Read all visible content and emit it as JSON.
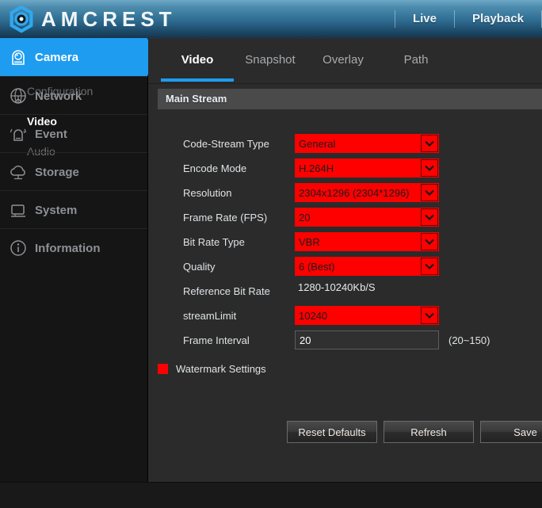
{
  "header": {
    "brand": "AMCREST",
    "logo_icon": "amcrest-hex-logo",
    "nav": [
      {
        "label": "Live",
        "icon": "live-link"
      },
      {
        "label": "Playback",
        "icon": "playback-link"
      }
    ]
  },
  "sidebar": {
    "groups": [
      {
        "label": "Camera",
        "icon": "camera-dome-icon",
        "active": true,
        "children": [
          {
            "label": "Configuration",
            "current": false
          },
          {
            "label": "Video",
            "current": true
          },
          {
            "label": "Audio",
            "current": false
          }
        ]
      },
      {
        "label": "Network",
        "icon": "network-globe-icon",
        "active": false,
        "children": []
      },
      {
        "label": "Event",
        "icon": "event-bell-icon",
        "active": false,
        "children": []
      },
      {
        "label": "Storage",
        "icon": "storage-cloud-icon",
        "active": false,
        "children": []
      },
      {
        "label": "System",
        "icon": "system-monitor-icon",
        "active": false,
        "children": []
      },
      {
        "label": "Information",
        "icon": "information-circle-icon",
        "active": false,
        "children": []
      }
    ]
  },
  "tabs": [
    {
      "label": "Video",
      "active": true
    },
    {
      "label": "Snapshot",
      "active": false
    },
    {
      "label": "Overlay",
      "active": false
    },
    {
      "label": "Path",
      "active": false
    }
  ],
  "section": {
    "title": "Main Stream"
  },
  "fields": {
    "code_stream_type": {
      "label": "Code-Stream Type",
      "value": "General",
      "type": "select",
      "highlight": true
    },
    "encode_mode": {
      "label": "Encode Mode",
      "value": "H.264H",
      "type": "select",
      "highlight": true
    },
    "resolution": {
      "label": "Resolution",
      "value": "2304x1296 (2304*1296)",
      "type": "select",
      "highlight": true
    },
    "frame_rate": {
      "label": "Frame Rate (FPS)",
      "value": "20",
      "type": "select",
      "highlight": true
    },
    "bit_rate_type": {
      "label": "Bit Rate Type",
      "value": "VBR",
      "type": "select",
      "highlight": true
    },
    "quality": {
      "label": "Quality",
      "value": "6 (Best)",
      "type": "select",
      "highlight": true
    },
    "reference_bit_rate": {
      "label": "Reference Bit Rate",
      "value": "1280-10240Kb/S",
      "type": "static"
    },
    "stream_limit": {
      "label": "streamLimit",
      "value": "10240",
      "type": "select",
      "highlight": true
    },
    "frame_interval": {
      "label": "Frame Interval",
      "value": "20",
      "type": "text",
      "hint": "(20~150)"
    },
    "watermark": {
      "label": "Watermark Settings",
      "checked": true
    }
  },
  "buttons": {
    "reset": "Reset Defaults",
    "refresh": "Refresh",
    "save": "Save"
  },
  "colors": {
    "accent_blue": "#1e9cf0",
    "highlight_red": "#fe0000",
    "panel_bg": "#2b2b2b",
    "sidebar_bg": "#151515"
  }
}
